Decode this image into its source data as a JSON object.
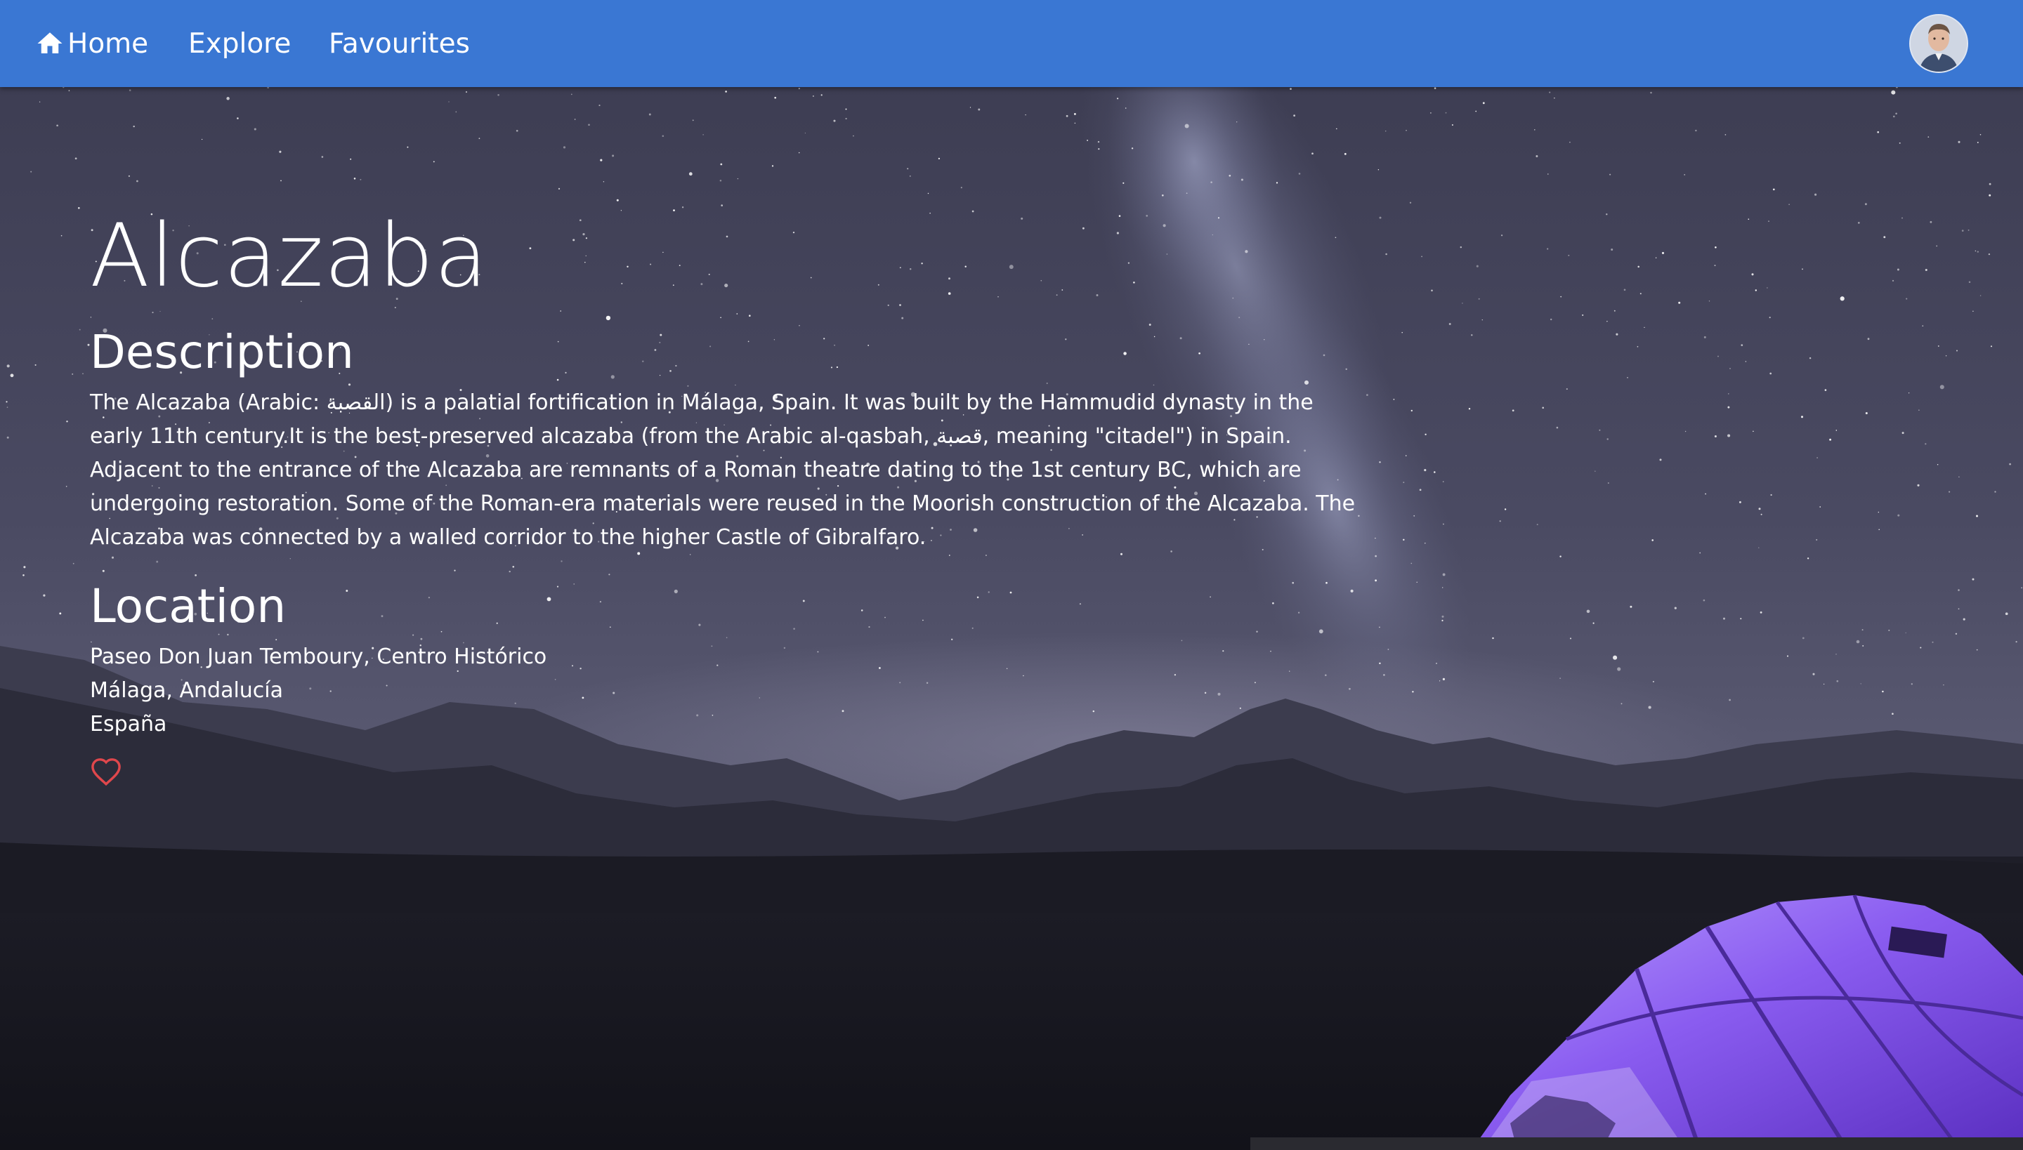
{
  "nav": {
    "home_label": "Home",
    "explore_label": "Explore",
    "favourites_label": "Favourites"
  },
  "place": {
    "title": "Alcazaba",
    "description_heading": "Description",
    "description": "The Alcazaba (Arabic: القصبة) is a palatial fortification in Málaga, Spain. It was built by the Hammudid dynasty in the early 11th century.It is the best-preserved alcazaba (from the Arabic al-qasbah, قصبة, meaning \"citadel\") in Spain. Adjacent to the entrance of the Alcazaba are remnants of a Roman theatre dating to the 1st century BC, which are undergoing restoration. Some of the Roman-era materials were reused in the Moorish construction of the Alcazaba. The Alcazaba was connected by a walled corridor to the higher Castle of Gibralfaro.",
    "location_heading": "Location",
    "location_lines": [
      "Paseo Don Juan Temboury, Centro Histórico",
      "Málaga, Andalucía",
      "España"
    ]
  },
  "icons": {
    "home": "home-icon",
    "favourite": "heart-outline-icon",
    "avatar": "user-avatar"
  },
  "colors": {
    "navbar": "#3a77d3",
    "heart": "#e0474c",
    "tent": "#8a5cf0",
    "sky_top": "#3a3a4e",
    "ground": "#15151d"
  }
}
